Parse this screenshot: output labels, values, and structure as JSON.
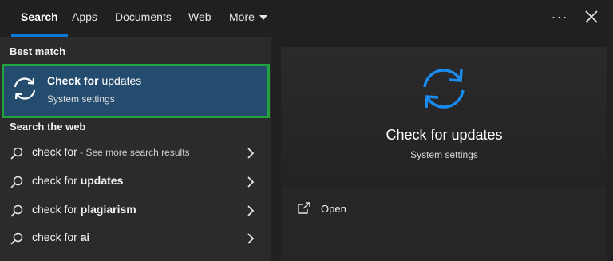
{
  "tabs": [
    {
      "label": "Search",
      "active": true
    },
    {
      "label": "Apps"
    },
    {
      "label": "Documents"
    },
    {
      "label": "Web"
    },
    {
      "label": "More"
    }
  ],
  "window_controls": {
    "menu_label": "···"
  },
  "best_match": {
    "section_title": "Best match",
    "title_bold": "Check for",
    "title_rest": " updates",
    "subtitle": "System settings",
    "icon": "sync-icon"
  },
  "web": {
    "section_title": "Search the web",
    "results": [
      {
        "prefix": "check for",
        "bold": "",
        "suffix": " - See more search results"
      },
      {
        "prefix": "check for ",
        "bold": "updates",
        "suffix": ""
      },
      {
        "prefix": "check for ",
        "bold": "plagiarism",
        "suffix": ""
      },
      {
        "prefix": "check for ",
        "bold": "ai",
        "suffix": ""
      }
    ]
  },
  "preview": {
    "title": "Check for updates",
    "subtitle": "System settings",
    "icon": "sync-icon",
    "actions": [
      {
        "label": "Open",
        "icon": "open-external-icon"
      }
    ]
  },
  "colors": {
    "accent": "#0a78d4",
    "highlight_border": "#21a340",
    "selected_bg": "#244c6e"
  }
}
